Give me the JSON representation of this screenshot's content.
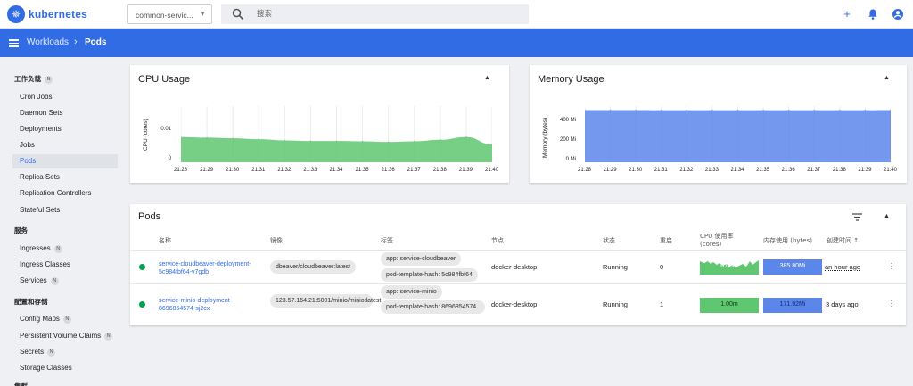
{
  "app": {
    "brand": "kubernetes"
  },
  "namespace": {
    "value": "common-servic..."
  },
  "search": {
    "placeholder": "搜索"
  },
  "breadcrumb": {
    "parent": "Workloads",
    "current": "Pods"
  },
  "sidebar": {
    "sections": [
      {
        "title": "工作负载",
        "badge": "N",
        "items": [
          "Cron Jobs",
          "Daemon Sets",
          "Deployments",
          "Jobs",
          "Pods",
          "Replica Sets",
          "Replication Controllers",
          "Stateful Sets"
        ]
      },
      {
        "title": "服务",
        "badge": "",
        "items": [
          "Ingresses",
          "Ingress Classes",
          "Services"
        ]
      },
      {
        "title": "配置和存储",
        "badge": "",
        "items": [
          "Config Maps",
          "Persistent Volume Claims",
          "Secrets",
          "Storage Classes"
        ]
      },
      {
        "title": "集群",
        "badge": "",
        "items": []
      }
    ],
    "item_badges": {
      "Ingresses": "N",
      "Services": "N",
      "Config Maps": "N",
      "Persistent Volume Claims": "N",
      "Secrets": "N"
    },
    "active": "Pods"
  },
  "cpu_card": {
    "title": "CPU Usage",
    "y_label": "CPU (cores)",
    "y_ticks": [
      "0.01",
      "0"
    ],
    "x_ticks": [
      "21:28",
      "21:29",
      "21:30",
      "21:31",
      "21:32",
      "21:33",
      "21:34",
      "21:35",
      "21:36",
      "21:37",
      "21:38",
      "21:39",
      "21:40"
    ]
  },
  "mem_card": {
    "title": "Memory Usage",
    "y_label": "Memory (bytes)",
    "y_ticks": [
      "400 Mi",
      "200 Mi",
      "0 Mi"
    ],
    "x_ticks": [
      "21:28",
      "21:29",
      "21:30",
      "21:31",
      "21:32",
      "21:33",
      "21:34",
      "21:35",
      "21:36",
      "21:37",
      "21:38",
      "21:39",
      "21:40"
    ]
  },
  "chart_data": [
    {
      "type": "area",
      "title": "CPU Usage",
      "ylabel": "CPU (cores)",
      "x": [
        "21:28",
        "21:29",
        "21:30",
        "21:31",
        "21:32",
        "21:33",
        "21:34",
        "21:35",
        "21:36",
        "21:37",
        "21:38",
        "21:39",
        "21:40"
      ],
      "y": [
        0.0083,
        0.0081,
        0.0079,
        0.0076,
        0.0072,
        0.007,
        0.007,
        0.0069,
        0.0067,
        0.0069,
        0.0074,
        0.0083,
        0.0059
      ],
      "ylim": [
        0,
        0.0185
      ],
      "color": "#5fc770"
    },
    {
      "type": "area",
      "title": "Memory Usage",
      "ylabel": "Memory (bytes)",
      "x": [
        "21:28",
        "21:29",
        "21:30",
        "21:31",
        "21:32",
        "21:33",
        "21:34",
        "21:35",
        "21:36",
        "21:37",
        "21:38",
        "21:39",
        "21:40"
      ],
      "y": [
        557,
        557,
        557,
        556,
        556,
        556,
        556,
        556,
        556,
        556,
        556,
        556,
        557
      ],
      "ylim": [
        0,
        600
      ],
      "color": "#5b86ea"
    }
  ],
  "pods_card": {
    "title": "Pods",
    "columns": [
      "名称",
      "镜像",
      "标签",
      "节点",
      "状态",
      "重启",
      "CPU 使用率 (cores)",
      "内存使用 (bytes)",
      "创建时间"
    ],
    "rows": [
      {
        "name": "service-cloudbeaver-deployment-5c984fbf64-v7gdb",
        "image": "dbeaver/cloudbeaver:latest",
        "labels": [
          "app: service-cloudbeaver",
          "pod-template-hash: 5c984fbf64"
        ],
        "node": "docker-desktop",
        "status": "Running",
        "restarts": "0",
        "cpu": "6.00m",
        "memory": "385.80Mi",
        "created": "an hour ago"
      },
      {
        "name": "service-minio-deployment-8696854574-sj2cx",
        "image": "123.57.164.21:5001/minio/minio:latest",
        "labels": [
          "app: service-minio",
          "pod-template-hash: 8696854574"
        ],
        "node": "docker-desktop",
        "status": "Running",
        "restarts": "1",
        "cpu": "1.00m",
        "memory": "171.92Mi",
        "created": "3 days ago"
      }
    ]
  },
  "colors": {
    "primary": "#326ce5",
    "cpu_fill": "#5fc770",
    "mem_fill": "#5b86ea",
    "running": "#00a14b"
  }
}
